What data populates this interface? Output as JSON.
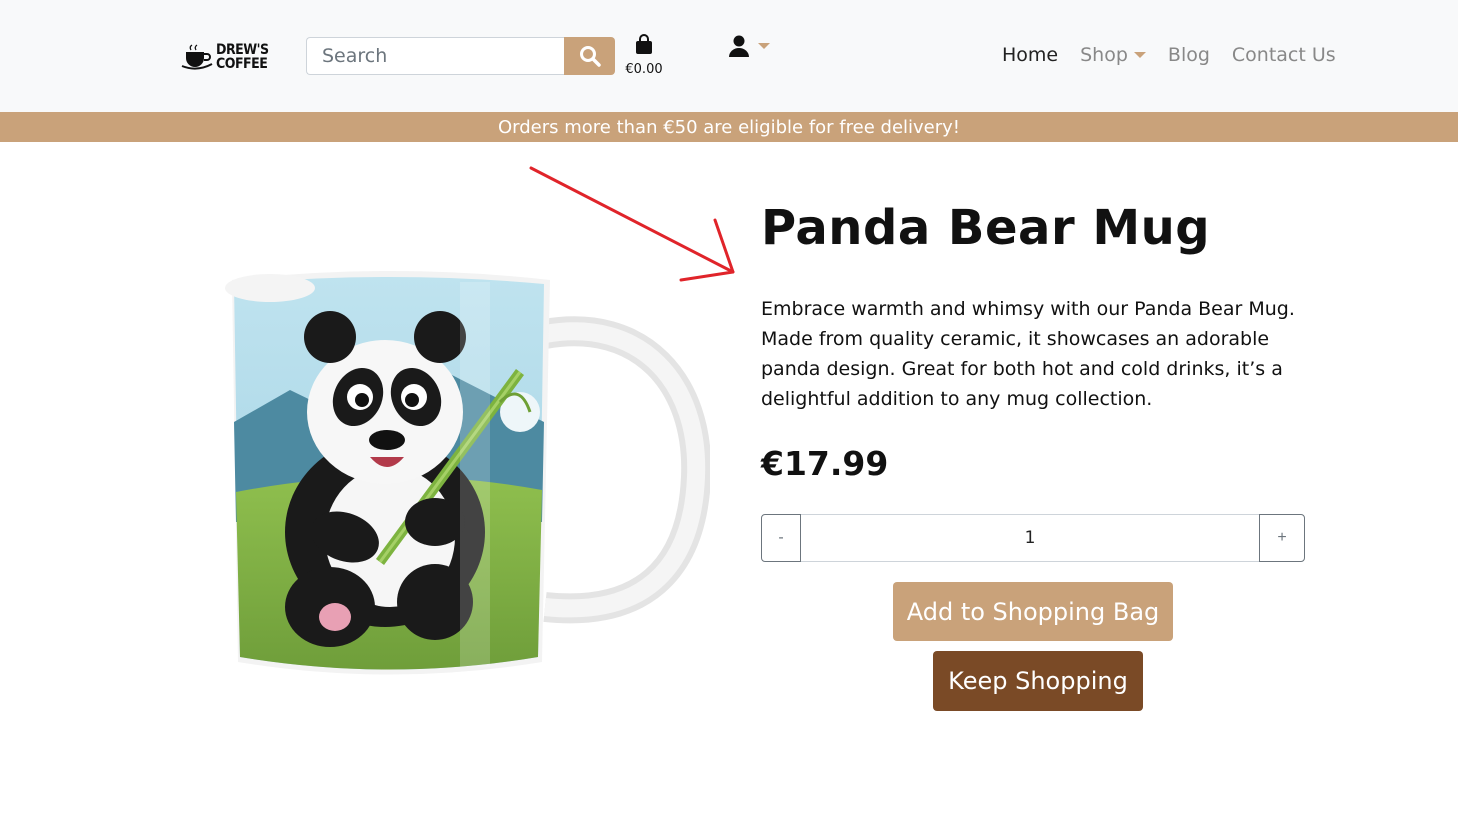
{
  "header": {
    "logo_line1": "DREW'S",
    "logo_line2": "COFFEE",
    "search": {
      "placeholder": "Search",
      "value": ""
    },
    "cart_total": "€0.00",
    "nav": [
      {
        "label": "Home",
        "active": true
      },
      {
        "label": "Shop",
        "has_dropdown": true
      },
      {
        "label": "Blog"
      },
      {
        "label": "Contact Us"
      }
    ]
  },
  "banner": {
    "text": "Orders more than €50 are eligible for free delivery!"
  },
  "product": {
    "title": "Panda Bear Mug",
    "description": "Embrace warmth and whimsy with our Panda Bear Mug. Made from quality ceramic, it showcases an adorable panda design. Great for both hot and cold drinks, it’s a delightful addition to any mug collection.",
    "price": "€17.99",
    "quantity": "1",
    "minus_label": "-",
    "plus_label": "+",
    "add_button": "Add to Shopping Bag",
    "keep_button": "Keep Shopping"
  },
  "colors": {
    "accent": "#c9a27a",
    "dark_brown": "#7a4a26",
    "annotation_arrow": "#e0242a"
  },
  "icons": [
    "coffee-cup-logo-icon",
    "search-icon",
    "shopping-bag-icon",
    "user-icon",
    "chevron-down-icon"
  ]
}
